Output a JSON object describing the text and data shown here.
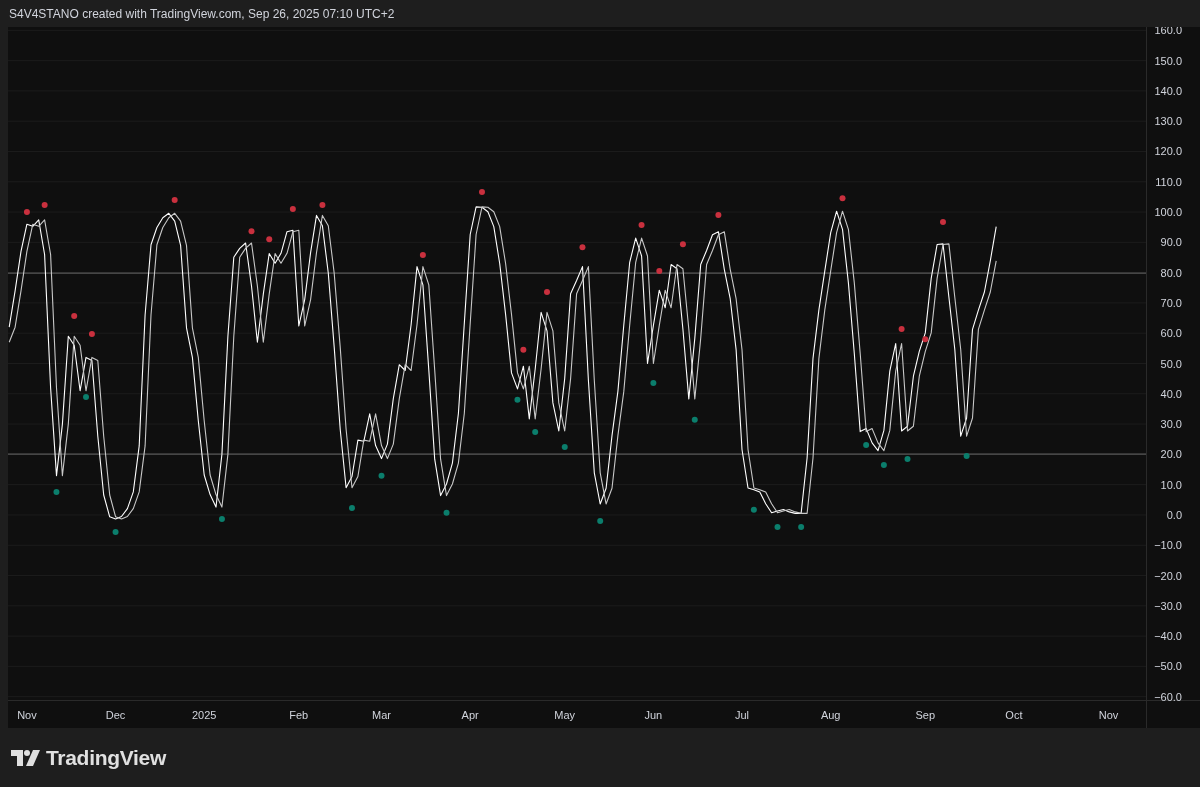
{
  "header": {
    "text": "S4V4STANO created with TradingView.com, Sep 26, 2025 07:10 UTC+2"
  },
  "chart": {
    "chart_data": {
      "type": "line",
      "ylim": [
        -61.1,
        161.1
      ],
      "categories": [
        null,
        null,
        null,
        "Nov",
        null,
        null,
        null,
        null,
        null,
        null,
        null,
        null,
        null,
        null,
        null,
        null,
        null,
        null,
        "Dec",
        null,
        null,
        null,
        null,
        null,
        null,
        null,
        null,
        null,
        null,
        null,
        null,
        null,
        null,
        "2025",
        null,
        null,
        null,
        null,
        null,
        null,
        null,
        null,
        null,
        null,
        null,
        null,
        null,
        null,
        null,
        "Feb",
        null,
        null,
        null,
        null,
        null,
        null,
        null,
        null,
        null,
        null,
        null,
        null,
        null,
        "Mar",
        null,
        null,
        null,
        null,
        null,
        null,
        null,
        null,
        null,
        null,
        null,
        null,
        null,
        null,
        "Apr",
        null,
        null,
        null,
        null,
        null,
        null,
        null,
        null,
        null,
        null,
        null,
        null,
        null,
        null,
        null,
        "May",
        null,
        null,
        null,
        null,
        null,
        null,
        null,
        null,
        null,
        null,
        null,
        null,
        null,
        null,
        "Jun",
        null,
        null,
        null,
        null,
        null,
        null,
        null,
        null,
        null,
        null,
        null,
        null,
        null,
        null,
        "Jul",
        null,
        null,
        null,
        null,
        null,
        null,
        null,
        null,
        null,
        null,
        null,
        null,
        null,
        null,
        "Aug",
        null,
        null,
        null,
        null,
        null,
        null,
        null,
        null,
        null,
        null,
        null,
        null,
        null,
        null,
        null,
        "Sep",
        null,
        null,
        null,
        null,
        null,
        null,
        null,
        null,
        null,
        null,
        null,
        null,
        null,
        null,
        "Oct",
        null,
        null,
        null,
        null,
        null,
        null,
        null,
        null,
        null,
        null,
        null,
        null,
        null,
        null,
        null,
        "Nov",
        null,
        null,
        null,
        null,
        null,
        null
      ],
      "series": [
        {
          "color": "#ffffff",
          "values": [
            62,
            74,
            87,
            96,
            95.3,
            97.4,
            86,
            42,
            13,
            30,
            59,
            56,
            41,
            52,
            51,
            26,
            6.6,
            -0.6,
            -1.3,
            -0.5,
            2.1,
            7.6,
            22.8,
            66,
            89.2,
            94.9,
            98.1,
            99.6,
            97,
            89,
            61.8,
            52,
            31.1,
            13.2,
            6.7,
            2.6,
            20,
            59,
            85.1,
            88,
            89.8,
            75.6,
            57,
            72.9,
            86.3,
            83.1,
            86.4,
            93.5,
            94,
            62.4,
            71.1,
            86.6,
            98.9,
            95.5,
            79.8,
            55.4,
            28.3,
            9,
            12.7,
            24.7,
            24.3,
            33.4,
            22.9,
            18.6,
            23.4,
            38.4,
            49.6,
            47.7,
            62.8,
            82,
            76,
            47.9,
            18.4,
            6.4,
            10.2,
            17.1,
            33.5,
            63.2,
            92.6,
            101.7,
            101.6,
            100.1,
            95.2,
            83,
            66.2,
            46.9,
            41.6,
            49.1,
            31.7,
            48.2,
            66.9,
            60.8,
            37,
            27.7,
            45,
            73,
            77.4,
            82,
            44.5,
            13.9,
            3.6,
            8.8,
            26.2,
            40.8,
            62.7,
            83.4,
            91.4,
            85.5,
            50,
            62.6,
            74.2,
            68.4,
            82.7,
            81.3,
            61.4,
            38.3,
            58.3,
            82.7,
            87.3,
            92.5,
            93.5,
            81.1,
            71.4,
            54.6,
            21.6,
            8.9,
            8.3,
            7.6,
            3.7,
            0.7,
            1.3,
            1.8,
            1,
            0.5,
            0.5,
            18.8,
            51.7,
            67.7,
            80.6,
            93.2,
            100.3,
            94.3,
            76.6,
            53.3,
            27.5,
            28.5,
            23.8,
            21.2,
            27.9,
            47.5,
            56.6,
            27.7,
            29.3,
            45.8,
            54,
            60.1,
            78.1,
            89.3,
            89.5,
            71.9,
            54.7,
            26,
            32,
            61.3,
            67.6,
            73.6,
            83.9,
            95.2,
            null,
            null,
            null,
            null,
            null,
            null,
            null,
            null,
            null,
            null,
            null,
            null,
            null,
            null,
            null,
            null,
            null,
            null,
            null,
            null,
            null,
            null,
            null,
            null,
            null
          ]
        },
        {
          "color": "#c8c8c8",
          "values": [
            57,
            62,
            74,
            87,
            96,
            95.3,
            97.4,
            86,
            42,
            13,
            30,
            59,
            56,
            41,
            52,
            51,
            26,
            6.6,
            -0.6,
            -1.3,
            -0.5,
            2.1,
            7.6,
            22.8,
            66,
            89.2,
            94.9,
            98.1,
            99.6,
            97,
            89,
            61.8,
            52,
            31.1,
            13.2,
            6.7,
            2.6,
            20,
            59,
            85.1,
            88,
            89.8,
            75.6,
            57,
            72.9,
            86.3,
            83.1,
            86.4,
            93.5,
            94,
            62.4,
            71.1,
            86.6,
            98.9,
            95.5,
            79.8,
            55.4,
            28.3,
            9,
            12.7,
            24.7,
            24.3,
            33.4,
            22.9,
            18.6,
            23.4,
            38.4,
            49.6,
            47.7,
            62.8,
            82,
            76,
            47.9,
            18.4,
            6.4,
            10.2,
            17.1,
            33.5,
            63.2,
            92.6,
            101.7,
            101.6,
            100.1,
            95.2,
            83,
            66.2,
            46.9,
            41.6,
            49.1,
            31.7,
            48.2,
            66.9,
            60.8,
            37,
            27.7,
            45,
            73,
            77.4,
            82,
            44.5,
            13.9,
            3.6,
            8.8,
            26.2,
            40.8,
            62.7,
            83.4,
            91.4,
            85.5,
            50,
            62.6,
            74.2,
            68.4,
            82.7,
            81.3,
            61.4,
            38.3,
            58.3,
            82.7,
            87.3,
            92.5,
            93.5,
            81.1,
            71.4,
            54.6,
            21.6,
            8.9,
            8.3,
            7.6,
            3.7,
            0.7,
            1.3,
            1.8,
            1,
            0.5,
            0.5,
            18.8,
            51.7,
            67.7,
            80.6,
            93.2,
            100.3,
            94.3,
            76.6,
            53.3,
            27.5,
            28.5,
            23.8,
            21.2,
            27.9,
            47.5,
            56.6,
            27.7,
            29.3,
            45.8,
            54,
            60.1,
            78.1,
            89.3,
            89.5,
            71.9,
            54.7,
            26,
            32,
            61.3,
            67.6,
            73.6,
            83.9,
            null,
            null,
            null,
            null,
            null,
            null,
            null,
            null,
            null,
            null,
            null,
            null,
            null,
            null,
            null,
            null,
            null,
            null,
            null,
            null,
            null,
            null,
            null,
            null,
            null
          ]
        },
        {
          "type": "scatter",
          "color": "#c9303e",
          "values": [
            null,
            null,
            null,
            100,
            null,
            null,
            102.3,
            null,
            null,
            null,
            null,
            65.7,
            null,
            null,
            59.7,
            null,
            null,
            null,
            null,
            null,
            null,
            null,
            null,
            null,
            null,
            null,
            null,
            null,
            104,
            null,
            null,
            null,
            null,
            null,
            null,
            null,
            null,
            null,
            null,
            null,
            null,
            93.7,
            null,
            null,
            91,
            null,
            null,
            null,
            101,
            null,
            null,
            null,
            null,
            102.3,
            null,
            null,
            null,
            null,
            null,
            null,
            null,
            null,
            null,
            null,
            null,
            null,
            null,
            null,
            null,
            null,
            85.8,
            null,
            null,
            null,
            null,
            null,
            null,
            null,
            null,
            null,
            106.6,
            null,
            null,
            null,
            null,
            null,
            null,
            54.5,
            null,
            null,
            null,
            73.6,
            null,
            null,
            null,
            null,
            null,
            88.4,
            null,
            null,
            null,
            null,
            null,
            null,
            null,
            null,
            null,
            95.7,
            null,
            null,
            80.5,
            null,
            null,
            null,
            89.4,
            null,
            null,
            null,
            null,
            null,
            99,
            null,
            null,
            null,
            null,
            null,
            null,
            null,
            null,
            null,
            null,
            null,
            null,
            null,
            null,
            null,
            null,
            null,
            null,
            null,
            null,
            104.6,
            null,
            null,
            null,
            null,
            null,
            null,
            null,
            null,
            null,
            61.4,
            null,
            null,
            null,
            58,
            null,
            null,
            96.7,
            null,
            null,
            null,
            null,
            null,
            null,
            null,
            null,
            null,
            null,
            null,
            null,
            null,
            null,
            null,
            null,
            null,
            null,
            null,
            null,
            null,
            null,
            null,
            null,
            null,
            null,
            null,
            null,
            null,
            null,
            null,
            null,
            null,
            null
          ]
        },
        {
          "type": "scatter",
          "color": "#0b7e6c",
          "values": [
            null,
            null,
            null,
            null,
            null,
            null,
            null,
            null,
            7.6,
            null,
            null,
            null,
            null,
            38.9,
            null,
            null,
            null,
            null,
            -5.6,
            null,
            null,
            null,
            null,
            null,
            null,
            null,
            null,
            null,
            null,
            null,
            null,
            null,
            null,
            null,
            null,
            null,
            -1.3,
            null,
            null,
            null,
            null,
            null,
            null,
            null,
            null,
            null,
            null,
            null,
            null,
            null,
            null,
            null,
            null,
            null,
            null,
            null,
            null,
            null,
            2.3,
            null,
            null,
            null,
            null,
            12.9,
            null,
            null,
            null,
            null,
            null,
            null,
            null,
            null,
            null,
            null,
            0.7,
            null,
            null,
            null,
            null,
            null,
            null,
            null,
            null,
            null,
            null,
            null,
            38,
            null,
            null,
            27.4,
            null,
            null,
            null,
            null,
            22.4,
            null,
            null,
            null,
            null,
            null,
            -2,
            null,
            null,
            null,
            null,
            null,
            null,
            null,
            null,
            43.6,
            null,
            null,
            null,
            null,
            null,
            null,
            31.4,
            null,
            null,
            null,
            null,
            null,
            null,
            null,
            null,
            null,
            1.7,
            null,
            null,
            null,
            -4,
            null,
            null,
            null,
            -4,
            null,
            null,
            null,
            null,
            null,
            null,
            null,
            null,
            null,
            null,
            23.1,
            null,
            null,
            16.5,
            null,
            null,
            null,
            18.5,
            null,
            null,
            null,
            null,
            null,
            null,
            null,
            null,
            null,
            19.5,
            null,
            null,
            null,
            null,
            null,
            null,
            null,
            null,
            null,
            null,
            null,
            null,
            null,
            null,
            null,
            null,
            null,
            null,
            null,
            null,
            null,
            null,
            null,
            null,
            null,
            null,
            null,
            null,
            null,
            null
          ]
        }
      ],
      "grid": true,
      "ref_lines": [
        {
          "axis": "y",
          "value": 80
        },
        {
          "axis": "y",
          "value": 20
        }
      ],
      "yticks": [
        {
          "value": 160,
          "label": "160.0"
        },
        {
          "value": 150,
          "label": "150.0"
        },
        {
          "value": 140,
          "label": "140.0"
        },
        {
          "value": 130,
          "label": "130.0"
        },
        {
          "value": 120,
          "label": "120.0"
        },
        {
          "value": 110,
          "label": "110.0"
        },
        {
          "value": 100,
          "label": "100.0"
        },
        {
          "value": 90,
          "label": "90.0"
        },
        {
          "value": 80,
          "label": "80.0"
        },
        {
          "value": 70,
          "label": "70.0"
        },
        {
          "value": 60,
          "label": "60.0"
        },
        {
          "value": 50,
          "label": "50.0"
        },
        {
          "value": 40,
          "label": "40.0"
        },
        {
          "value": 30,
          "label": "30.0"
        },
        {
          "value": 20,
          "label": "20.0"
        },
        {
          "value": 10,
          "label": "10.0"
        },
        {
          "value": 0,
          "label": "0.0"
        },
        {
          "value": -10,
          "label": "−10.0"
        },
        {
          "value": -20,
          "label": "−20.0"
        },
        {
          "value": -30,
          "label": "−30.0"
        },
        {
          "value": -40,
          "label": "−40.0"
        },
        {
          "value": -50,
          "label": "−50.0"
        },
        {
          "value": -60,
          "label": "−60.0"
        }
      ]
    }
  },
  "footer": {
    "logo_text": "TradingView"
  }
}
